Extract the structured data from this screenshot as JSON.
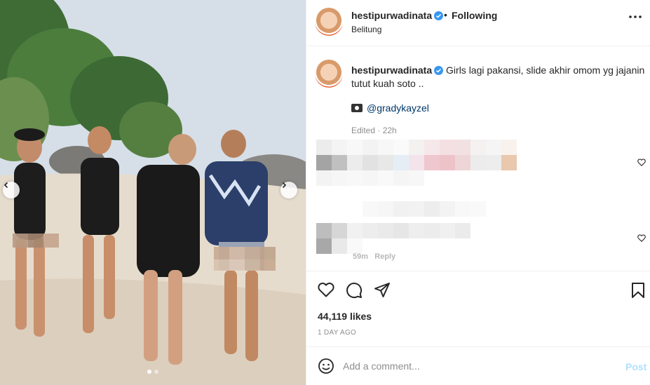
{
  "post": {
    "username": "hestipurwadinata",
    "verified": true,
    "separator": "•",
    "follow_label": "Following",
    "location": "Belitung"
  },
  "caption": {
    "username": "hestipurwadinata",
    "text": "Girls lagi pakansi, slide akhir omom yg jajanin tutut kuah soto ..",
    "mention": "@gradykayzel",
    "edited": "Edited · 22h"
  },
  "comments": {
    "reply_label": "Reply",
    "time_partial": "59m"
  },
  "engagement": {
    "likes": "44,119 likes",
    "posted": "1 DAY AGO"
  },
  "composer": {
    "placeholder": "Add a comment...",
    "post_label": "Post"
  },
  "media": {
    "slide_count": 2,
    "active_slide": 1
  },
  "colors": {
    "verified_blue": "#3897f0",
    "link": "#00376b",
    "post_disabled": "#b2dffc",
    "muted": "#8e8e8e"
  },
  "icons": [
    "more-icon",
    "heart-icon",
    "comment-icon",
    "share-icon",
    "save-icon",
    "emoji-icon",
    "chevron-left-icon",
    "chevron-right-icon",
    "verified-badge-icon"
  ]
}
